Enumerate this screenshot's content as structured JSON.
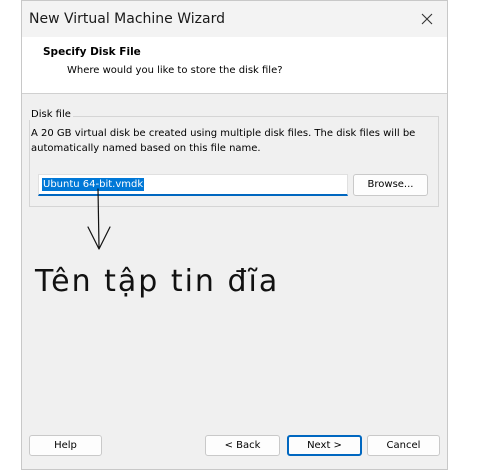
{
  "window": {
    "title": "New Virtual Machine Wizard"
  },
  "header": {
    "title": "Specify Disk File",
    "subtitle": "Where would you like to store the disk file?"
  },
  "disk_file": {
    "group_label": "Disk file",
    "description": "A 20 GB virtual disk be created using multiple disk files. The disk files will be automatically named based on this file name.",
    "filename_value": "Ubuntu 64-bit.vmdk",
    "browse_label": "Browse..."
  },
  "annotation": {
    "text": "Tên tập tin đĩa"
  },
  "footer": {
    "help_label": "Help",
    "back_label": "< Back",
    "next_label": "Next >",
    "cancel_label": "Cancel"
  },
  "colors": {
    "accent": "#0067c0",
    "selection": "#0078d7",
    "window_bg": "#f0f0f0"
  }
}
